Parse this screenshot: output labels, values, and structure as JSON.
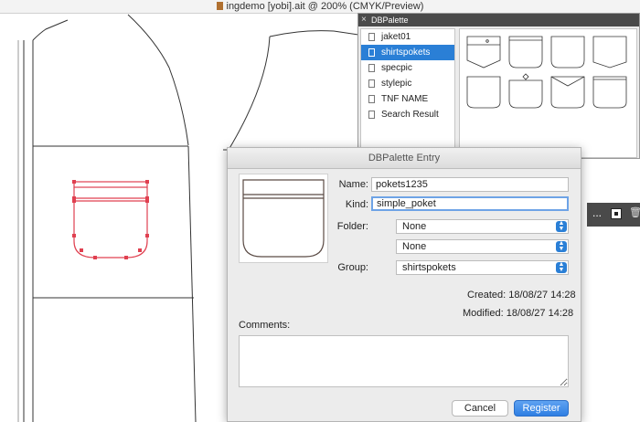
{
  "document": {
    "title": "ingdemo [yobi].ait @ 200% (CMYK/Preview)"
  },
  "palette": {
    "title": "DBPalette",
    "items": [
      {
        "label": "jaket01",
        "selected": false
      },
      {
        "label": "shirtspokets",
        "selected": true
      },
      {
        "label": "specpic",
        "selected": false
      },
      {
        "label": "stylepic",
        "selected": false
      },
      {
        "label": "TNF NAME",
        "selected": false
      },
      {
        "label": "Search Result",
        "selected": false
      }
    ],
    "toolbar": {
      "more": "..."
    }
  },
  "dialog": {
    "title": "DBPalette Entry",
    "name_label": "Name:",
    "name_value": "pokets1235",
    "kind_label": "Kind:",
    "kind_value": "simple_poket",
    "folder_label": "Folder:",
    "folder_value": "None",
    "subfolder_value": "None",
    "group_label": "Group:",
    "group_value": "shirtspokets",
    "created_label": "Created:",
    "created_value": "18/08/27 14:28",
    "modified_label": "Modified:",
    "modified_value": "18/08/27 14:28",
    "comments_label": "Comments:",
    "comments_value": "",
    "cancel_label": "Cancel",
    "register_label": "Register"
  },
  "colors": {
    "accent": "#2a7fd6",
    "selection_outline": "#e04050"
  }
}
